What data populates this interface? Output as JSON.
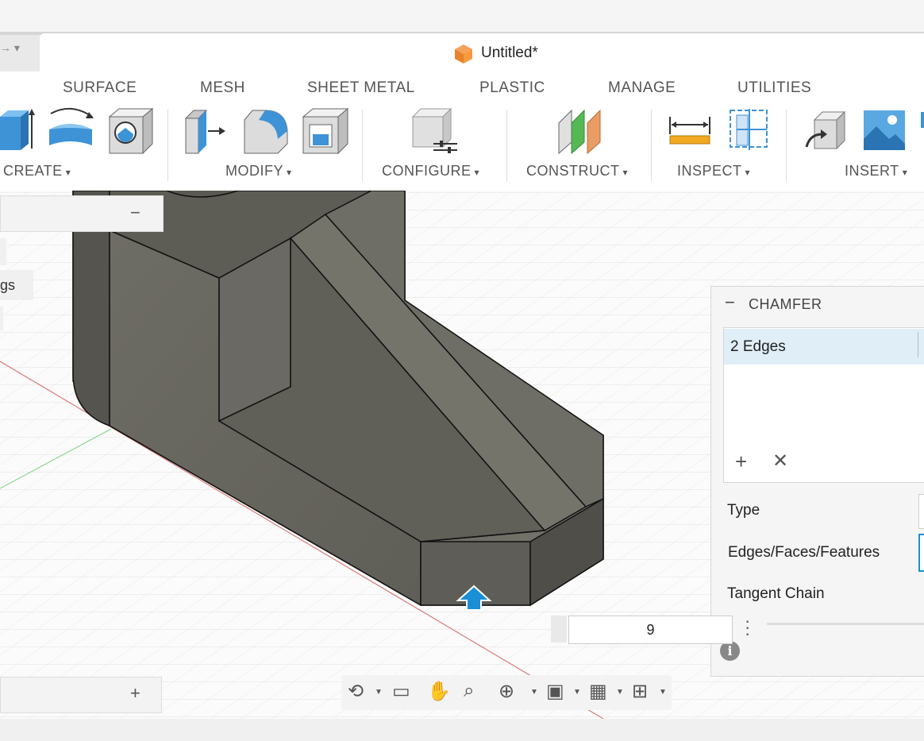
{
  "window": {
    "title": "Untitled*",
    "nav_arrows": "→ ▾"
  },
  "ribbon": {
    "tabs": [
      "SURFACE",
      "MESH",
      "SHEET METAL",
      "PLASTIC",
      "MANAGE",
      "UTILITIES"
    ],
    "groups": [
      "CREATE",
      "MODIFY",
      "CONFIGURE",
      "CONSTRUCT",
      "INSPECT",
      "INSERT"
    ],
    "caret": "▾",
    "tool_icons": [
      "extrude-icon",
      "revolve-icon",
      "hole-icon",
      "press-pull-icon",
      "fillet-icon",
      "shell-icon",
      "configure-icon",
      "offset-plane-icon",
      "measure-icon",
      "section-analysis-icon",
      "insert-derive-icon",
      "insert-image-icon"
    ]
  },
  "browser": {
    "collapse": "−",
    "partial_label": "gs"
  },
  "comments": {
    "add": "+"
  },
  "chamfer_panel": {
    "title": "CHAMFER",
    "collapse": "−",
    "selection": "2 Edges",
    "add": "+",
    "remove": "✕",
    "rows": [
      "Type",
      "Edges/Faces/Features",
      "Tangent Chain"
    ],
    "info": "i"
  },
  "distance_input": {
    "value": "9"
  },
  "navigation_bar": {
    "icons": [
      "orbit-icon",
      "look-at-icon",
      "pan-icon",
      "zoom-icon",
      "fit-icon",
      "display-settings-icon",
      "grid-icon",
      "viewports-icon"
    ]
  },
  "colors": {
    "accent": "#1a8fd6",
    "model_body": "#6b6a62",
    "selection_highlight": "#dfeef7"
  }
}
